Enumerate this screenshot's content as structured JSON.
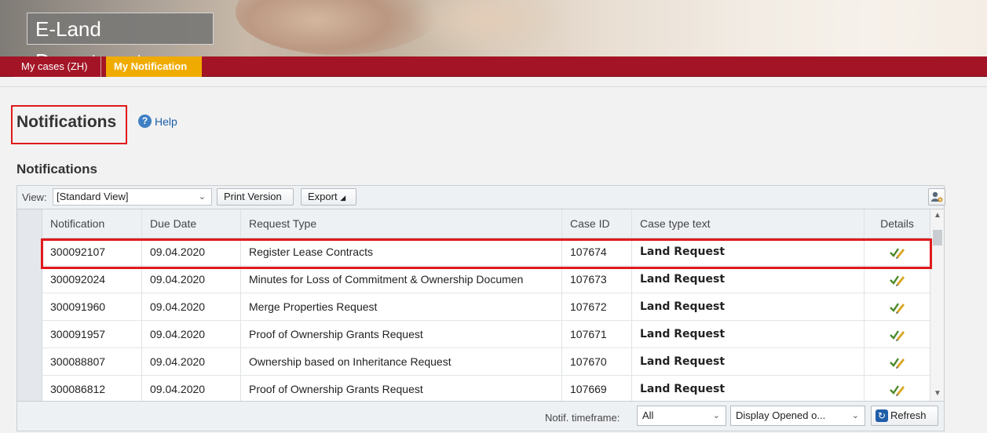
{
  "header": {
    "app_title": "E-Land Department",
    "tabs": [
      {
        "label": "My cases (ZH)",
        "active": false
      },
      {
        "label": "My Notification",
        "active": true
      }
    ]
  },
  "page": {
    "title": "Notifications",
    "help_label": "Help",
    "section_title": "Notifications"
  },
  "toolbar": {
    "view_label": "View:",
    "view_value": "[Standard View]",
    "print_label": "Print Version",
    "export_label": "Export"
  },
  "table": {
    "columns": [
      "Notification",
      "Due Date",
      "Request Type",
      "Case ID",
      "Case type text",
      "Details"
    ],
    "rows": [
      {
        "notification": "300092107",
        "due_date": "09.04.2020",
        "request_type": "Register Lease Contracts",
        "case_id": "107674",
        "case_type": "Land Request"
      },
      {
        "notification": "300092024",
        "due_date": "09.04.2020",
        "request_type": "Minutes for Loss of Commitment & Ownership Documen",
        "case_id": "107673",
        "case_type": "Land Request"
      },
      {
        "notification": "300091960",
        "due_date": "09.04.2020",
        "request_type": "Merge Properties Request",
        "case_id": "107672",
        "case_type": "Land Request"
      },
      {
        "notification": "300091957",
        "due_date": "09.04.2020",
        "request_type": "Proof of Ownership Grants Request",
        "case_id": "107671",
        "case_type": "Land Request"
      },
      {
        "notification": "300088807",
        "due_date": "09.04.2020",
        "request_type": "Ownership based on Inheritance Request",
        "case_id": "107670",
        "case_type": "Land Request"
      },
      {
        "notification": "300086812",
        "due_date": "09.04.2020",
        "request_type": "Proof of Ownership Grants Request",
        "case_id": "107669",
        "case_type": "Land Request"
      }
    ]
  },
  "footer": {
    "timeframe_label": "Notif. timeframe:",
    "timeframe_value": "All",
    "display_value": "Display Opened o...",
    "refresh_label": "Refresh"
  },
  "colors": {
    "brand_red": "#a31526",
    "active_tab": "#f0ab00",
    "highlight": "#e0191b"
  },
  "icons": {
    "help": "help-icon",
    "details": "edit-check-icon",
    "settings": "personalize-icon",
    "refresh": "refresh-icon"
  }
}
